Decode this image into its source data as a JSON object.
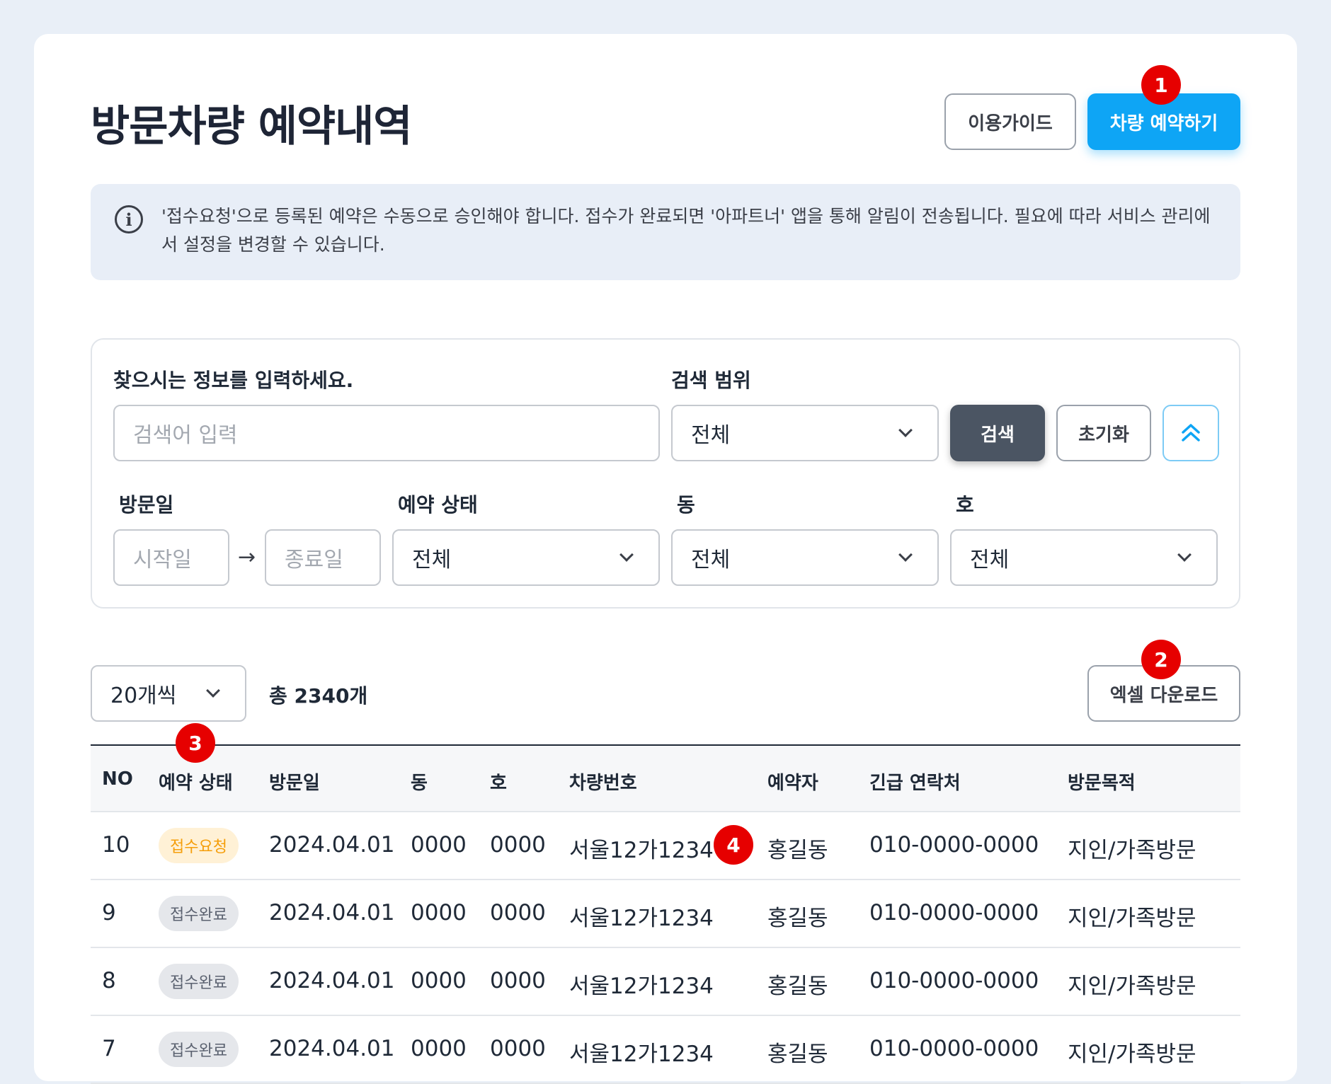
{
  "page": {
    "title": "방문차량 예약내역",
    "guide_button": "이용가이드",
    "reserve_button": "차량 예약하기"
  },
  "notice": {
    "text": "'접수요청'으로 등록된 예약은 수동으로 승인해야 합니다. 접수가 완료되면 '아파트너' 앱을 통해 알림이 전송됩니다. 필요에 따라 서비스 관리에서 설정을 변경할 수 있습니다."
  },
  "filter": {
    "keyword_label": "찾으시는 정보를 입력하세요.",
    "keyword_placeholder": "검색어 입력",
    "scope_label": "검색 범위",
    "scope_value": "전체",
    "search_button": "검색",
    "reset_button": "초기화",
    "visit_date_label": "방문일",
    "start_placeholder": "시작일",
    "end_placeholder": "종료일",
    "status_label": "예약 상태",
    "status_value": "전체",
    "dong_label": "동",
    "dong_value": "전체",
    "ho_label": "호",
    "ho_value": "전체"
  },
  "list": {
    "per_page": "20개씩",
    "total": "총 2340개",
    "excel_button": "엑셀 다운로드"
  },
  "table": {
    "headers": [
      "NO",
      "예약 상태",
      "방문일",
      "동",
      "호",
      "차량번호",
      "예약자",
      "긴급 연락처",
      "방문목적"
    ],
    "rows": [
      {
        "no": "10",
        "status": "접수요청",
        "date": "2024.04.01",
        "dong": "0000",
        "ho": "0000",
        "car": "서울12가1234",
        "name": "홍길동",
        "phone": "010-0000-0000",
        "purpose": "지인/가족방문"
      },
      {
        "no": "9",
        "status": "접수완료",
        "date": "2024.04.01",
        "dong": "0000",
        "ho": "0000",
        "car": "서울12가1234",
        "name": "홍길동",
        "phone": "010-0000-0000",
        "purpose": "지인/가족방문"
      },
      {
        "no": "8",
        "status": "접수완료",
        "date": "2024.04.01",
        "dong": "0000",
        "ho": "0000",
        "car": "서울12가1234",
        "name": "홍길동",
        "phone": "010-0000-0000",
        "purpose": "지인/가족방문"
      },
      {
        "no": "7",
        "status": "접수완료",
        "date": "2024.04.01",
        "dong": "0000",
        "ho": "0000",
        "car": "서울12가1234",
        "name": "홍길동",
        "phone": "010-0000-0000",
        "purpose": "지인/가족방문"
      }
    ]
  },
  "markers": [
    "1",
    "2",
    "3",
    "4"
  ],
  "colors": {
    "accent": "#0ea5f5",
    "marker": "#e60000",
    "badge_request_bg": "#fff1d6",
    "badge_request_text": "#f59e0b",
    "badge_done_bg": "#e5e7eb"
  }
}
